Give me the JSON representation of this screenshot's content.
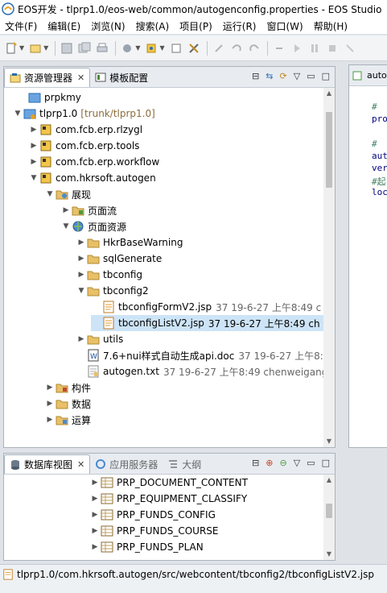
{
  "window": {
    "title": "EOS开发 - tlprp1.0/eos-web/common/autogenconfig.properties - EOS Studio"
  },
  "menu": [
    "文件(F)",
    "编辑(E)",
    "浏览(N)",
    "搜索(A)",
    "项目(P)",
    "运行(R)",
    "窗口(W)",
    "帮助(H)"
  ],
  "project_panel": {
    "tabs": [
      {
        "label": "资源管理器",
        "icon": "explorer-icon",
        "close": "✕"
      },
      {
        "label": "模板配置",
        "icon": "template-icon"
      }
    ],
    "tree": [
      {
        "label": "prpkmy",
        "icon": "project-icon"
      },
      {
        "label": "tlprp1.0",
        "meta": "[trunk/tlprp1.0]",
        "icon": "project-icon"
      },
      {
        "label": "com.fcb.erp.rlzygl",
        "icon": "package-icon"
      },
      {
        "label": "com.fcb.erp.tools",
        "icon": "package-icon"
      },
      {
        "label": "com.fcb.erp.workflow",
        "icon": "package-icon"
      },
      {
        "label": "com.hkrsoft.autogen",
        "icon": "package-icon"
      },
      {
        "label": "展现",
        "icon": "folder-icon"
      },
      {
        "label": "页面流",
        "icon": "folder-icon"
      },
      {
        "label": "页面资源",
        "icon": "globe-icon"
      },
      {
        "label": "HkrBaseWarning",
        "icon": "folder-icon"
      },
      {
        "label": "sqlGenerate",
        "icon": "folder-icon"
      },
      {
        "label": "tbconfig",
        "icon": "folder-icon"
      },
      {
        "label": "tbconfig2",
        "icon": "folder-icon"
      },
      {
        "label": "tbconfigFormV2.jsp",
        "meta": "37  19-6-27 上午8:49  c",
        "icon": "jsp-icon"
      },
      {
        "label": "tbconfigListV2.jsp",
        "meta": "37  19-6-27 上午8:49  ch",
        "icon": "jsp-icon"
      },
      {
        "label": "utils",
        "icon": "folder-icon"
      },
      {
        "label": "7.6+nui样式自动生成api.doc",
        "meta": "37  19-6-27 上午8:",
        "icon": "doc-icon"
      },
      {
        "label": "autogen.txt",
        "meta": "37  19-6-27 上午8:49  chenweigang",
        "icon": "txt-icon"
      },
      {
        "label": "构件",
        "icon": "folder-icon"
      },
      {
        "label": "数据",
        "icon": "folder-icon"
      },
      {
        "label": "运算",
        "icon": "folder-icon"
      }
    ]
  },
  "db_panel": {
    "tabs": [
      {
        "label": "数据库视图",
        "close": "✕"
      },
      {
        "label": "应用服务器"
      },
      {
        "label": "大纲"
      }
    ],
    "tables": [
      "PRP_DOCUMENT_CONTENT",
      "PRP_EQUIPMENT_CLASSIFY",
      "PRP_FUNDS_CONFIG",
      "PRP_FUNDS_COURSE",
      "PRP_FUNDS_PLAN"
    ]
  },
  "editor": {
    "tab": "auto",
    "lines": [
      "#",
      "pro",
      "#",
      "aut",
      "ver",
      "#起",
      "loc"
    ]
  },
  "status": {
    "path": "tlprp1.0/com.hkrsoft.autogen/src/webcontent/tbconfig2/tbconfigListV2.jsp"
  },
  "colors": {
    "selection": "#cde4f7",
    "folder": "#e8c068",
    "accent": "#2a6db3"
  }
}
